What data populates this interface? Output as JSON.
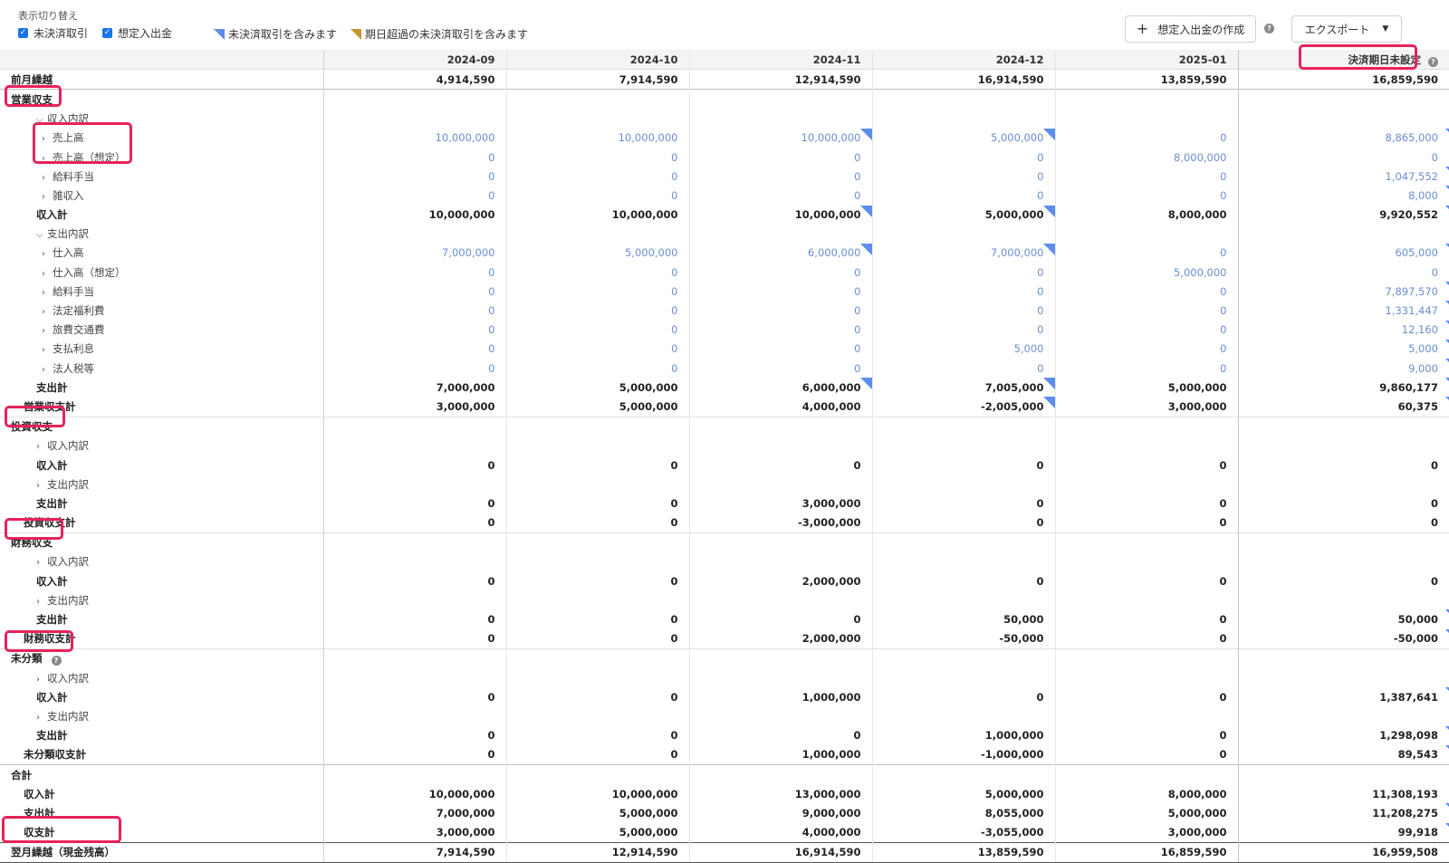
{
  "toolbar": {
    "title": "表示切り替え",
    "toggles": [
      "未決済取引",
      "想定入出金"
    ],
    "legend": [
      "未決済取引を含みます",
      "期日超過の未決済取引を含みます"
    ],
    "create_button": "想定入出金の作成",
    "export_button": "エクスポート"
  },
  "colors": {
    "accent": "#1a73e8",
    "marker_blue": "#5b8def",
    "marker_gold": "#c4952b",
    "highlight": "#e8225b"
  },
  "columns": [
    "2024-09",
    "2024-10",
    "2024-11",
    "2024-12",
    "2025-01",
    "決済期日未設定"
  ],
  "rows": [
    {
      "label": "前月繰越",
      "style": "bold",
      "values": [
        "4,914,590",
        "7,914,590",
        "12,914,590",
        "16,914,590",
        "13,859,590",
        "16,859,590"
      ]
    },
    {
      "label": "営業収支",
      "style": "cat"
    },
    {
      "label": "収入内訳",
      "style": "sub",
      "chev": "v"
    },
    {
      "label": "売上高",
      "style": "item",
      "chev": ">",
      "values": [
        "10,000,000",
        "10,000,000",
        "10,000,000",
        "5,000,000",
        "0",
        "8,865,000"
      ]
    },
    {
      "label": "売上高（想定）",
      "style": "item",
      "chev": ">",
      "values": [
        "0",
        "0",
        "0",
        "0",
        "8,000,000",
        "0"
      ]
    },
    {
      "label": "給料手当",
      "style": "item",
      "chev": ">",
      "values": [
        "0",
        "0",
        "0",
        "0",
        "0",
        "1,047,552"
      ]
    },
    {
      "label": "雑収入",
      "style": "item",
      "chev": ">",
      "values": [
        "0",
        "0",
        "0",
        "0",
        "0",
        "8,000"
      ]
    },
    {
      "label": "収入計",
      "style": "bold",
      "values": [
        "10,000,000",
        "10,000,000",
        "10,000,000",
        "5,000,000",
        "8,000,000",
        "9,920,552"
      ]
    },
    {
      "label": "支出内訳",
      "style": "sub",
      "chev": "v"
    },
    {
      "label": "仕入高",
      "style": "item",
      "chev": ">",
      "values": [
        "7,000,000",
        "5,000,000",
        "6,000,000",
        "7,000,000",
        "0",
        "605,000"
      ]
    },
    {
      "label": "仕入高（想定）",
      "style": "item",
      "chev": ">",
      "values": [
        "0",
        "0",
        "0",
        "0",
        "5,000,000",
        "0"
      ]
    },
    {
      "label": "給料手当",
      "style": "item",
      "chev": ">",
      "values": [
        "0",
        "0",
        "0",
        "0",
        "0",
        "7,897,570"
      ]
    },
    {
      "label": "法定福利費",
      "style": "item",
      "chev": ">",
      "values": [
        "0",
        "0",
        "0",
        "0",
        "0",
        "1,331,447"
      ]
    },
    {
      "label": "旅費交通費",
      "style": "item",
      "chev": ">",
      "values": [
        "0",
        "0",
        "0",
        "0",
        "0",
        "12,160"
      ]
    },
    {
      "label": "支払利息",
      "style": "item",
      "chev": ">",
      "values": [
        "0",
        "0",
        "0",
        "5,000",
        "0",
        "5,000"
      ]
    },
    {
      "label": "法人税等",
      "style": "item",
      "chev": ">",
      "values": [
        "0",
        "0",
        "0",
        "0",
        "0",
        "9,000"
      ]
    },
    {
      "label": "支出計",
      "style": "bold",
      "values": [
        "7,000,000",
        "5,000,000",
        "6,000,000",
        "7,005,000",
        "5,000,000",
        "9,860,177"
      ]
    },
    {
      "label": "営業収支計",
      "style": "bold",
      "values": [
        "3,000,000",
        "5,000,000",
        "4,000,000",
        "-2,005,000",
        "3,000,000",
        "60,375"
      ]
    },
    {
      "label": "投資収支",
      "style": "cat"
    },
    {
      "label": "収入内訳",
      "style": "sub",
      "chev": ">"
    },
    {
      "label": "収入計",
      "style": "bold",
      "values": [
        "0",
        "0",
        "0",
        "0",
        "0",
        "0"
      ]
    },
    {
      "label": "支出内訳",
      "style": "sub",
      "chev": ">"
    },
    {
      "label": "支出計",
      "style": "bold",
      "values": [
        "0",
        "0",
        "3,000,000",
        "0",
        "0",
        "0"
      ]
    },
    {
      "label": "投資収支計",
      "style": "bold",
      "values": [
        "0",
        "0",
        "-3,000,000",
        "0",
        "0",
        "0"
      ]
    },
    {
      "label": "財務収支",
      "style": "cat"
    },
    {
      "label": "収入内訳",
      "style": "sub",
      "chev": ">"
    },
    {
      "label": "収入計",
      "style": "bold",
      "values": [
        "0",
        "0",
        "2,000,000",
        "0",
        "0",
        "0"
      ]
    },
    {
      "label": "支出内訳",
      "style": "sub",
      "chev": ">"
    },
    {
      "label": "支出計",
      "style": "bold",
      "values": [
        "0",
        "0",
        "0",
        "50,000",
        "0",
        "50,000"
      ]
    },
    {
      "label": "財務収支計",
      "style": "bold",
      "values": [
        "0",
        "0",
        "2,000,000",
        "-50,000",
        "0",
        "-50,000"
      ]
    },
    {
      "label": "未分類",
      "style": "cat",
      "help": true
    },
    {
      "label": "収入内訳",
      "style": "sub",
      "chev": ">"
    },
    {
      "label": "収入計",
      "style": "bold",
      "values": [
        "0",
        "0",
        "1,000,000",
        "0",
        "0",
        "1,387,641"
      ]
    },
    {
      "label": "支出内訳",
      "style": "sub",
      "chev": ">"
    },
    {
      "label": "支出計",
      "style": "bold",
      "values": [
        "0",
        "0",
        "0",
        "1,000,000",
        "0",
        "1,298,098"
      ]
    },
    {
      "label": "未分類収支計",
      "style": "bold",
      "values": [
        "0",
        "0",
        "1,000,000",
        "-1,000,000",
        "0",
        "89,543"
      ]
    },
    {
      "label": "合計",
      "style": "total-head"
    },
    {
      "label": "収入計",
      "style": "bold",
      "values": [
        "10,000,000",
        "10,000,000",
        "13,000,000",
        "5,000,000",
        "8,000,000",
        "11,308,193"
      ]
    },
    {
      "label": "支出計",
      "style": "bold",
      "values": [
        "7,000,000",
        "5,000,000",
        "9,000,000",
        "8,055,000",
        "5,000,000",
        "11,208,275"
      ]
    },
    {
      "label": "収支計",
      "style": "bold",
      "values": [
        "3,000,000",
        "5,000,000",
        "4,000,000",
        "-3,055,000",
        "3,000,000",
        "99,918"
      ]
    },
    {
      "label": "翌月繰越（現金残高）",
      "style": "final",
      "values": [
        "7,914,590",
        "12,914,590",
        "16,914,590",
        "13,859,590",
        "16,859,590",
        "16,959,508"
      ]
    }
  ]
}
